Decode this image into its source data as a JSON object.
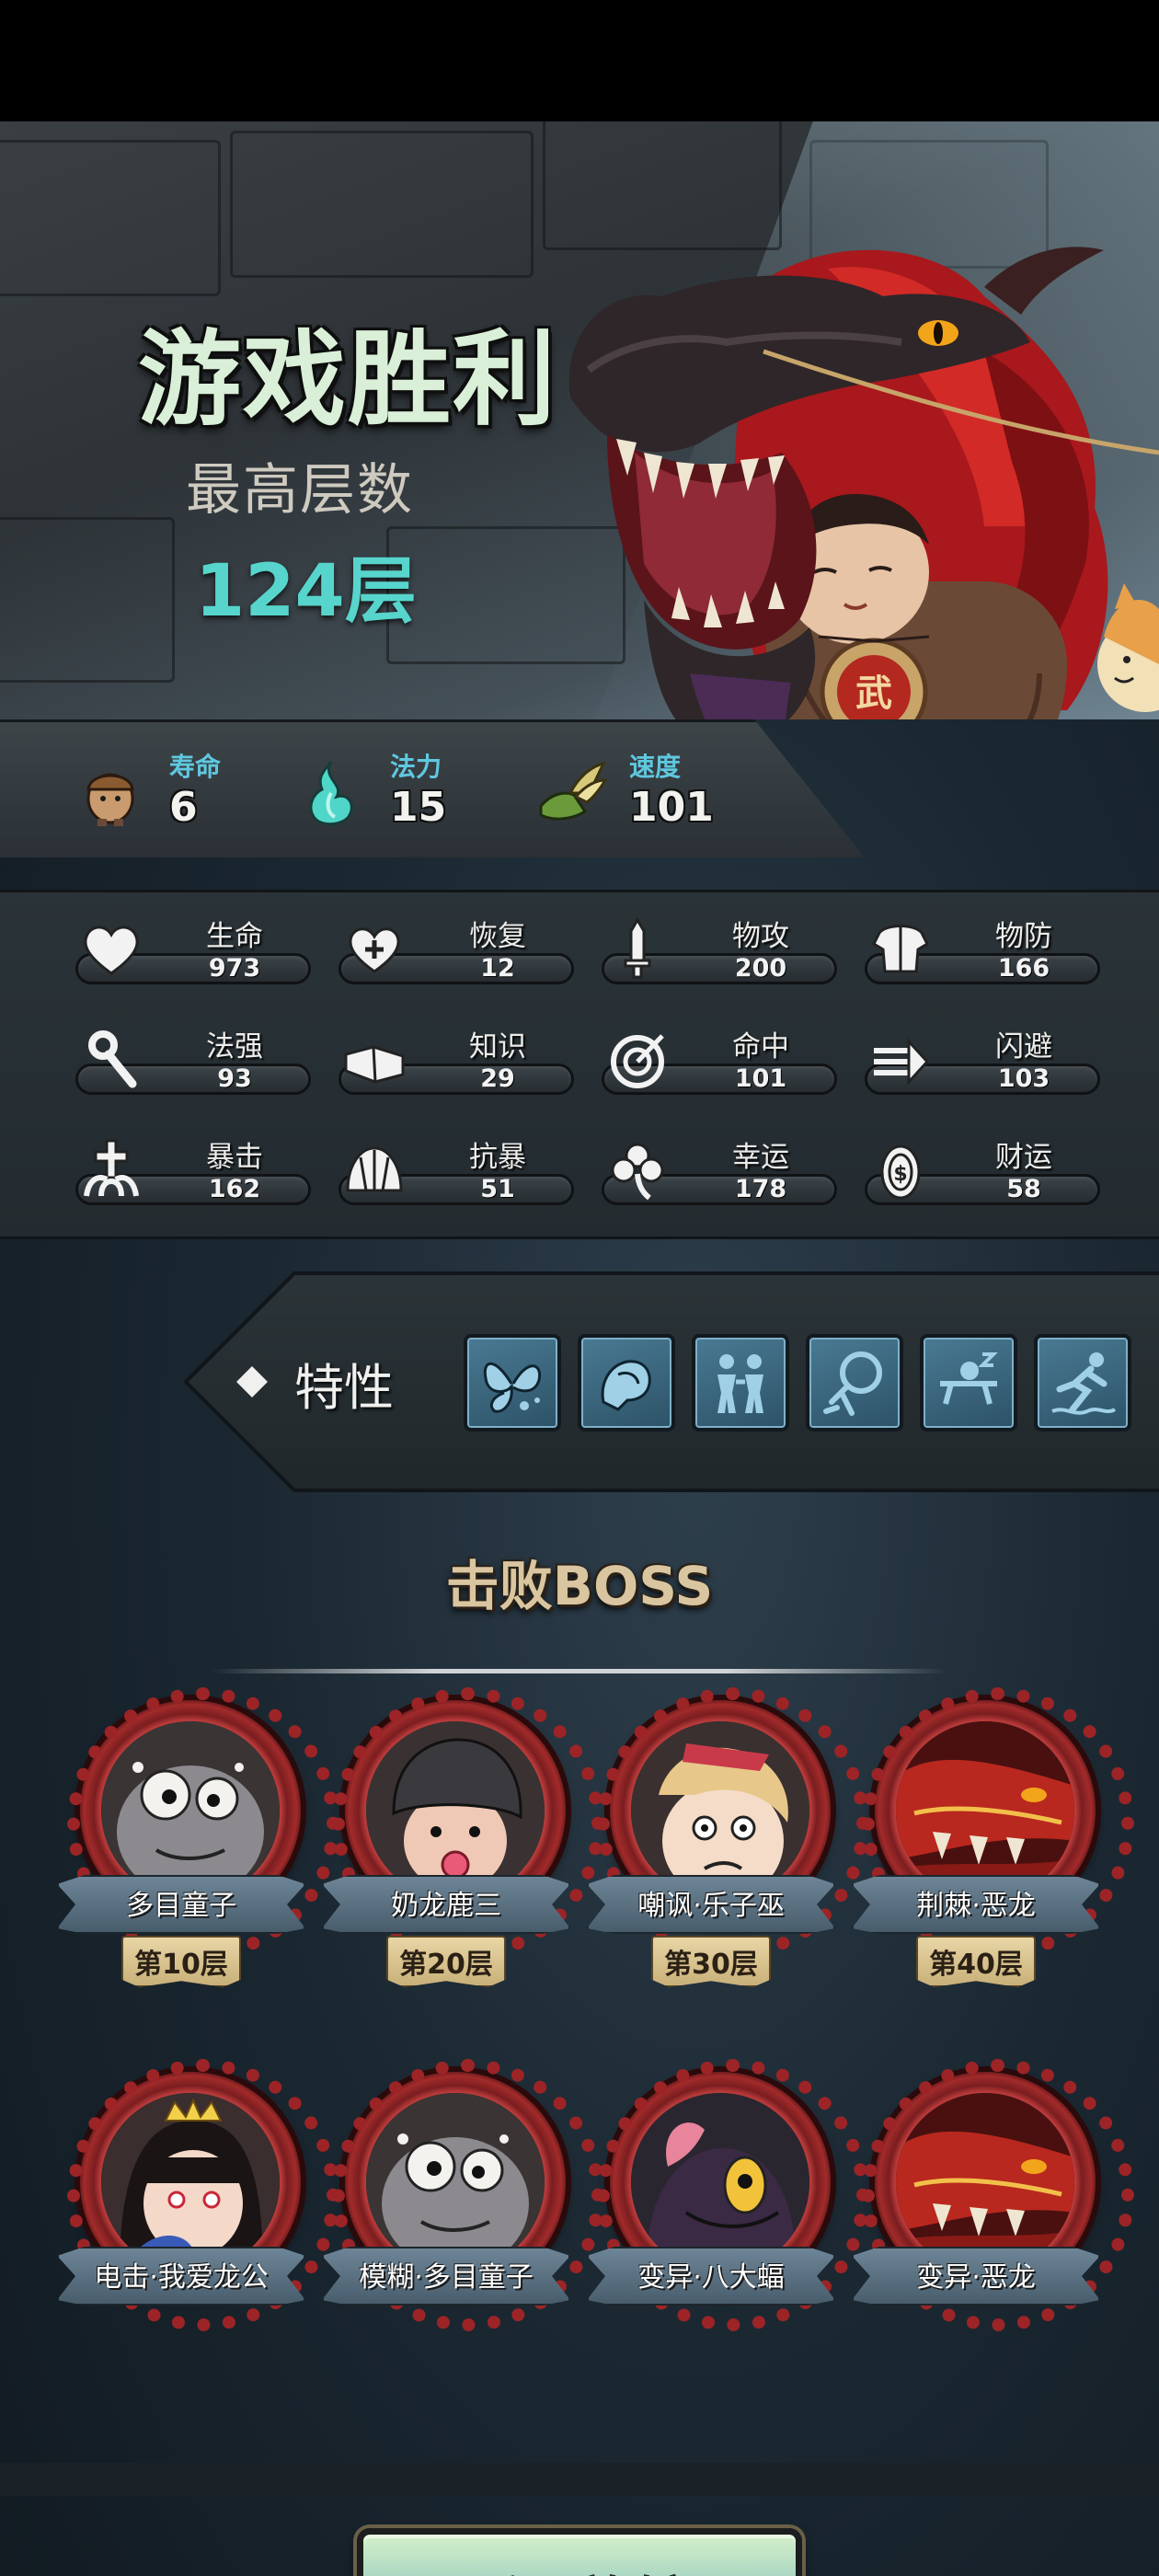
{
  "header": {
    "title": "游戏胜利",
    "max_floor_label": "最高层数",
    "max_floor_value": "124层"
  },
  "main_stats": [
    {
      "label": "寿命",
      "value": "6",
      "icon": "pawn-icon"
    },
    {
      "label": "法力",
      "value": "15",
      "icon": "spirit-flame-icon"
    },
    {
      "label": "速度",
      "value": "101",
      "icon": "winged-boot-icon"
    }
  ],
  "attributes": [
    {
      "label": "生命",
      "value": "973",
      "icon": "heart-icon"
    },
    {
      "label": "恢复",
      "value": "12",
      "icon": "heart-plus-icon"
    },
    {
      "label": "物攻",
      "value": "200",
      "icon": "sword-icon"
    },
    {
      "label": "物防",
      "value": "166",
      "icon": "armor-icon"
    },
    {
      "label": "法强",
      "value": "93",
      "icon": "staff-icon"
    },
    {
      "label": "知识",
      "value": "29",
      "icon": "book-icon"
    },
    {
      "label": "命中",
      "value": "101",
      "icon": "target-icon"
    },
    {
      "label": "闪避",
      "value": "103",
      "icon": "dodge-arrow-icon"
    },
    {
      "label": "暴击",
      "value": "162",
      "icon": "crit-cross-icon"
    },
    {
      "label": "抗暴",
      "value": "51",
      "icon": "shell-icon"
    },
    {
      "label": "幸运",
      "value": "178",
      "icon": "clover-icon"
    },
    {
      "label": "财运",
      "value": "58",
      "icon": "coin-icon"
    }
  ],
  "traits": {
    "label": "特性",
    "icons": [
      "butterfly-trait-icon",
      "fist-trait-icon",
      "twins-trait-icon",
      "ghost-trait-icon",
      "sleeping-trait-icon",
      "swimmer-trait-icon"
    ]
  },
  "bosses": {
    "title": "击败BOSS",
    "list": [
      {
        "name": "多目童子",
        "floor": "第10层",
        "portrait": "many-eyed-child"
      },
      {
        "name": "奶龙鹿三",
        "floor": "第20层",
        "portrait": "helmet-baby"
      },
      {
        "name": "嘲讽·乐子巫",
        "floor": "第30层",
        "portrait": "jester-witch"
      },
      {
        "name": "荆棘·恶龙",
        "floor": "第40层",
        "portrait": "red-dragon"
      },
      {
        "name": "电击·我爱龙公",
        "floor": "",
        "portrait": "crowned-lady"
      },
      {
        "name": "模糊·多目童子",
        "floor": "",
        "portrait": "many-eyed-child"
      },
      {
        "name": "变异·八大蝠",
        "floor": "",
        "portrait": "bat-beast"
      },
      {
        "name": "变异·恶龙",
        "floor": "",
        "portrait": "red-dragon"
      }
    ]
  },
  "footer": {
    "return_label": "返回旅馆"
  },
  "colors": {
    "title_text": "#d9efd7",
    "floor_value": "#57d5cc",
    "stat_label": "#5fc8e0",
    "boss_frame": "#b83a3a",
    "button_fill": "#a6d4c2"
  }
}
